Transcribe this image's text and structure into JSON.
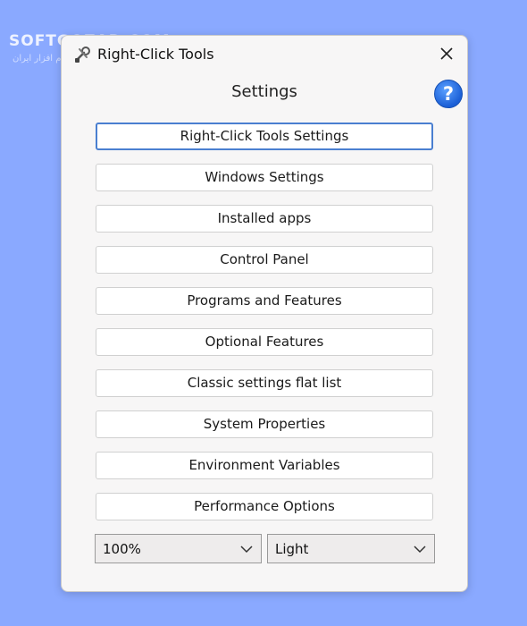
{
  "watermark": {
    "brand": "SOFTGOZAR.COM",
    "tagline": "دانلود نرم افزار ایران"
  },
  "window": {
    "title": "Right-Click Tools",
    "close_icon": "close-icon",
    "app_icon": "tools-icon"
  },
  "main": {
    "heading": "Settings",
    "help_label": "?",
    "buttons": [
      {
        "label": "Right-Click Tools Settings",
        "focused": true
      },
      {
        "label": "Windows Settings"
      },
      {
        "label": "Installed apps"
      },
      {
        "label": "Control Panel"
      },
      {
        "label": "Programs and Features"
      },
      {
        "label": "Optional Features"
      },
      {
        "label": "Classic settings flat list"
      },
      {
        "label": "System Properties"
      },
      {
        "label": "Environment Variables"
      },
      {
        "label": "Performance Options"
      }
    ]
  },
  "footer": {
    "zoom_value": "100%",
    "theme_value": "Light"
  },
  "colors": {
    "background": "#8aa9ff",
    "window": "#f7f6f6",
    "focus_border": "#4a7fd0",
    "help_blue": "#1b5fd6"
  }
}
